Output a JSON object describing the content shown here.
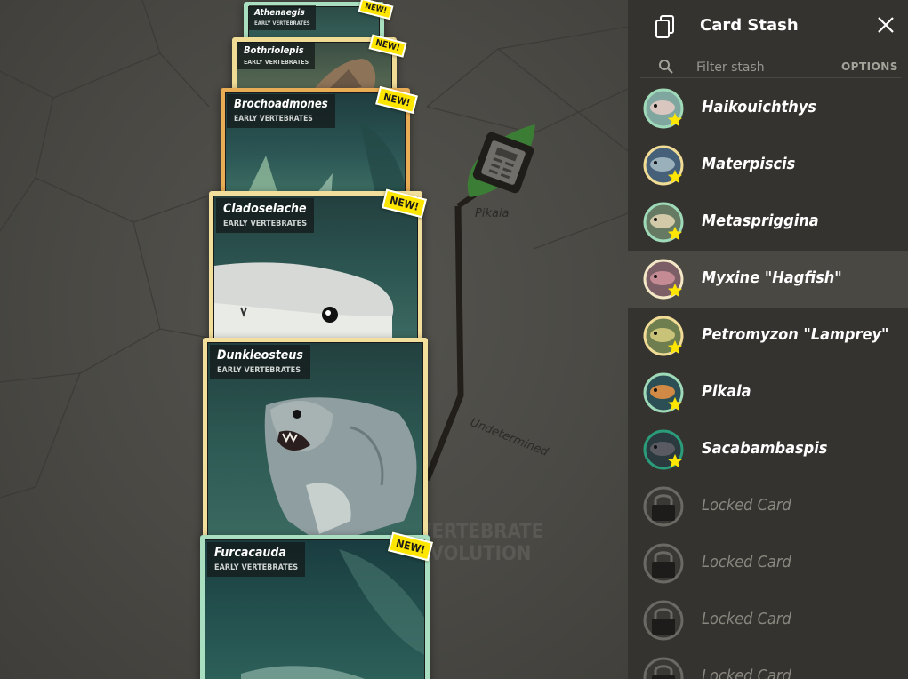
{
  "board": {
    "node_labels": [
      "Pikaia",
      "Undetermined"
    ],
    "watermark": "VERTEBRATE EVOLUTION"
  },
  "cards": [
    {
      "name": "Athenaegis",
      "category": "EARLY VERTEBRATES",
      "badge": "NEW!",
      "border": "#a9dfc0"
    },
    {
      "name": "Bothriolepis",
      "category": "EARLY VERTEBRATES",
      "badge": "NEW!",
      "border": "#f1dc96"
    },
    {
      "name": "Brochoadmones",
      "category": "EARLY VERTEBRATES",
      "badge": "NEW!",
      "border": "#e9ad55"
    },
    {
      "name": "Cladoselache",
      "category": "EARLY VERTEBRATES",
      "badge": "NEW!",
      "border": "#f3df9c"
    },
    {
      "name": "Dunkleosteus",
      "category": "EARLY VERTEBRATES",
      "badge": "",
      "border": "#f3df9c"
    },
    {
      "name": "Furcacauda",
      "category": "EARLY VERTEBRATES",
      "badge": "NEW!",
      "border": "#a9dfc0"
    }
  ],
  "stash": {
    "title": "Card Stash",
    "filter_placeholder": "Filter stash",
    "options_label": "OPTIONS",
    "items": [
      {
        "label": "Haikouichthys",
        "ring": "#9ed9b8",
        "locked": false,
        "selected": false
      },
      {
        "label": "Materpiscis",
        "ring": "#f1dc96",
        "locked": false,
        "selected": false
      },
      {
        "label": "Metaspriggina",
        "ring": "#9ed9b8",
        "locked": false,
        "selected": false
      },
      {
        "label": "Myxine \"Hagfish\"",
        "ring": "#f3e7c5",
        "locked": false,
        "selected": true
      },
      {
        "label": "Petromyzon \"Lamprey\"",
        "ring": "#f1dc96",
        "locked": false,
        "selected": false
      },
      {
        "label": "Pikaia",
        "ring": "#9ed9b8",
        "locked": false,
        "selected": false
      },
      {
        "label": "Sacabambaspis",
        "ring": "#2a9c7a",
        "locked": false,
        "selected": false
      },
      {
        "label": "Locked Card",
        "ring": "#6b6963",
        "locked": true,
        "selected": false
      },
      {
        "label": "Locked Card",
        "ring": "#6b6963",
        "locked": true,
        "selected": false
      },
      {
        "label": "Locked Card",
        "ring": "#6b6963",
        "locked": true,
        "selected": false
      },
      {
        "label": "Locked Card",
        "ring": "#6b6963",
        "locked": true,
        "selected": false
      }
    ]
  },
  "colors": {
    "badge": "#ffe600",
    "star": "#ffe600",
    "panel": "#35332f",
    "board": "#4b4a45"
  },
  "icons": [
    "card-stack-icon",
    "close-icon",
    "search-icon",
    "star-icon",
    "lock-icon",
    "pikaia-node-icon"
  ]
}
